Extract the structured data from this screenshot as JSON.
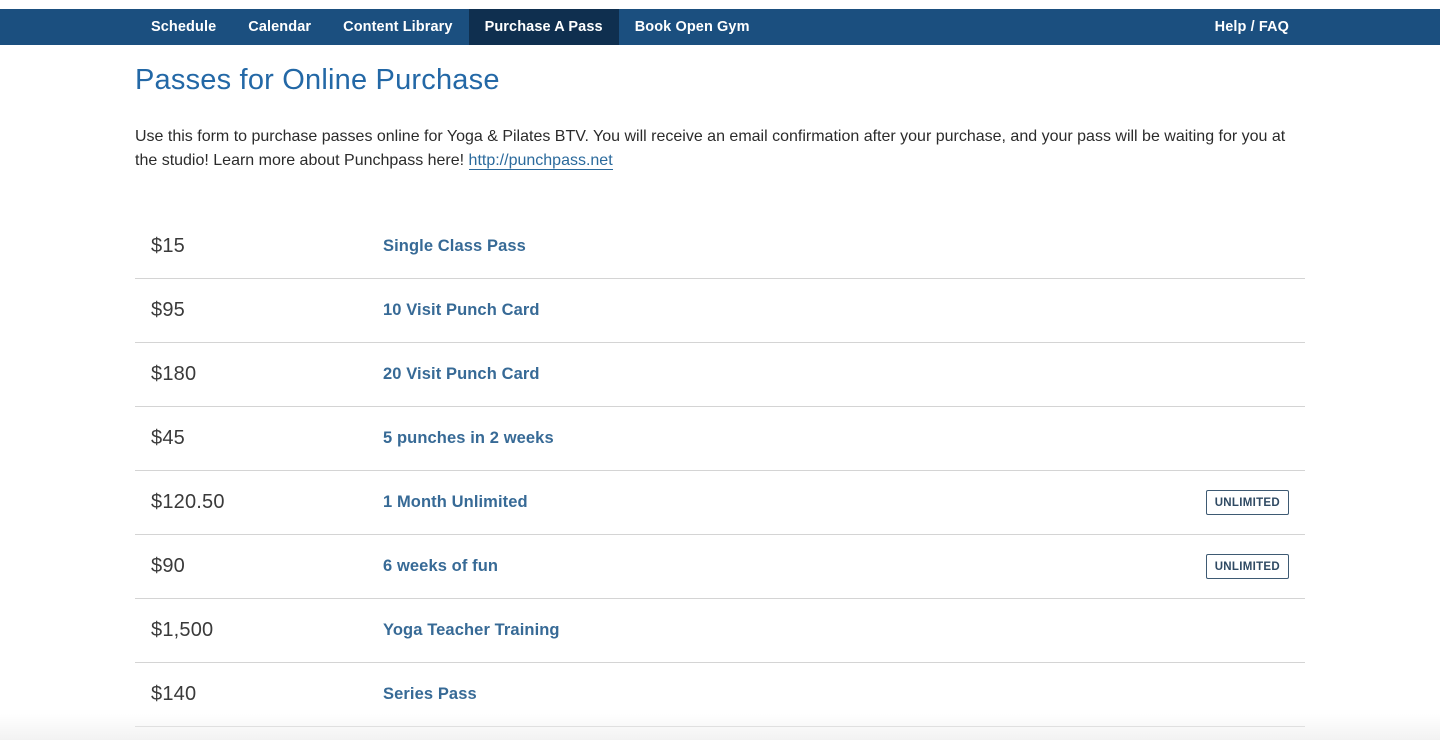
{
  "nav": {
    "items": [
      {
        "label": "Schedule"
      },
      {
        "label": "Calendar"
      },
      {
        "label": "Content Library"
      },
      {
        "label": "Purchase A Pass"
      },
      {
        "label": "Book Open Gym"
      }
    ],
    "active_item": "Purchase A Pass",
    "help_label": "Help / FAQ"
  },
  "page": {
    "title": "Passes for Online Purchase",
    "intro_text": "Use this form to purchase passes online for Yoga & Pilates BTV. You will receive an email confirmation after your purchase, and your pass will be waiting for you at the studio! Learn more about Punchpass here! ",
    "intro_link": "http://punchpass.net"
  },
  "passes": [
    {
      "price": "$15",
      "name": "Single Class Pass",
      "badge": ""
    },
    {
      "price": "$95",
      "name": "10 Visit Punch Card",
      "badge": ""
    },
    {
      "price": "$180",
      "name": "20 Visit Punch Card",
      "badge": ""
    },
    {
      "price": "$45",
      "name": "5 punches in 2 weeks",
      "badge": ""
    },
    {
      "price": "$120.50",
      "name": "1 Month Unlimited",
      "badge": "UNLIMITED"
    },
    {
      "price": "$90",
      "name": "6 weeks of fun",
      "badge": "UNLIMITED"
    },
    {
      "price": "$1,500",
      "name": "Yoga Teacher Training",
      "badge": ""
    },
    {
      "price": "$140",
      "name": "Series Pass",
      "badge": ""
    }
  ],
  "colors": {
    "nav_background": "#1b4f7f",
    "nav_active": "#0f2f4f",
    "title": "#2368a6",
    "pass_name": "#376a96"
  }
}
